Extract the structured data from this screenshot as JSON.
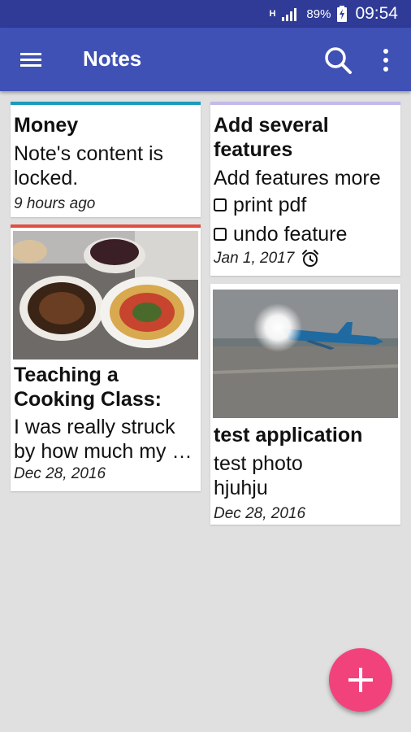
{
  "status_bar": {
    "network": "H",
    "battery": "89%",
    "time": "09:54"
  },
  "app_bar": {
    "title": "Notes",
    "icons": [
      "menu-icon",
      "search-icon",
      "more-vert-icon"
    ]
  },
  "notes": {
    "money": {
      "title": "Money",
      "body": "Note's content is locked.",
      "date": "9 hours ago",
      "accent": "#1a9bbd"
    },
    "features": {
      "title": "Add several features",
      "body": "Add features more",
      "checklist": [
        "print pdf",
        "undo feature"
      ],
      "date": "Jan 1, 2017",
      "accent": "#c5b9e8",
      "reminder_icon": "alarm-icon"
    },
    "cooking": {
      "title": "Teaching a Cooking Class: Ti…",
      "body": "I was really struck by how much my …",
      "date": "Dec 28, 2016",
      "accent": "#e04f42"
    },
    "test": {
      "title": "test application",
      "body": "test photo hjuhju",
      "date": "Dec 28, 2016"
    }
  },
  "fab": {
    "icon": "plus-icon",
    "color": "#f2427c"
  }
}
